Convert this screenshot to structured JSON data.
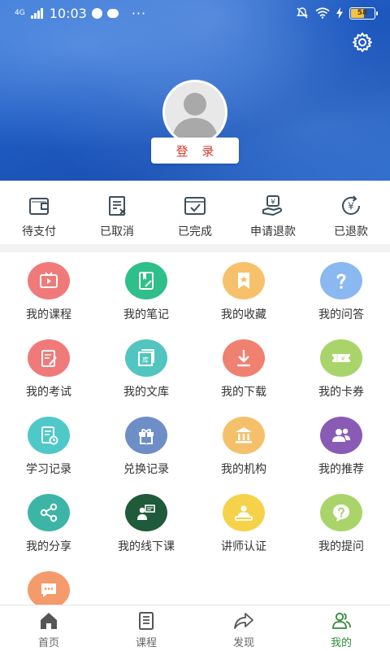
{
  "status_bar": {
    "network": "4G",
    "time": "10:03",
    "more": "···",
    "battery": "58",
    "battery_level_percent": 58
  },
  "header": {
    "login_label": "登 录"
  },
  "orders": [
    {
      "label": "待支付",
      "icon": "wallet-icon"
    },
    {
      "label": "已取消",
      "icon": "cancel-document-icon"
    },
    {
      "label": "已完成",
      "icon": "completed-check-icon"
    },
    {
      "label": "申请退款",
      "icon": "refund-request-icon"
    },
    {
      "label": "已退款",
      "icon": "refunded-yen-icon"
    }
  ],
  "grid": [
    {
      "label": "我的课程",
      "icon": "course-video-icon",
      "color": "#f07a7a"
    },
    {
      "label": "我的笔记",
      "icon": "note-icon",
      "color": "#2fbf8a"
    },
    {
      "label": "我的收藏",
      "icon": "favorite-bookmark-icon",
      "color": "#f7c06a"
    },
    {
      "label": "我的问答",
      "icon": "question-icon",
      "color": "#8ab8f0"
    },
    {
      "label": "我的考试",
      "icon": "exam-icon",
      "color": "#f07a7a"
    },
    {
      "label": "我的文库",
      "icon": "library-icon",
      "color": "#52c5c0"
    },
    {
      "label": "我的下载",
      "icon": "download-icon",
      "color": "#f08070"
    },
    {
      "label": "我的卡券",
      "icon": "coupon-icon",
      "color": "#a9d46a"
    },
    {
      "label": "学习记录",
      "icon": "study-record-icon",
      "color": "#4fc8c8"
    },
    {
      "label": "兑换记录",
      "icon": "gift-icon",
      "color": "#6e8ec7"
    },
    {
      "label": "我的机构",
      "icon": "institution-icon",
      "color": "#f5c06a"
    },
    {
      "label": "我的推荐",
      "icon": "recommend-users-icon",
      "color": "#8a5bb5"
    },
    {
      "label": "我的分享",
      "icon": "share-icon",
      "color": "#3cb5a6"
    },
    {
      "label": "我的线下课",
      "icon": "offline-class-icon",
      "color": "#1f5a3a"
    },
    {
      "label": "讲师认证",
      "icon": "lecturer-icon",
      "color": "#f5d24a"
    },
    {
      "label": "我的提问",
      "icon": "ask-question-icon",
      "color": "#a9d46a"
    },
    {
      "label": "",
      "icon": "message-icon",
      "color": "#f59a6a"
    }
  ],
  "bottom_nav": [
    {
      "label": "首页",
      "icon": "home-icon"
    },
    {
      "label": "课程",
      "icon": "course-list-icon"
    },
    {
      "label": "发现",
      "icon": "discover-icon"
    },
    {
      "label": "我的",
      "icon": "profile-users-icon"
    }
  ],
  "colors": {
    "accent": "#2e8b3a",
    "login_text": "#d33a2c",
    "header_blue": "#1f5bc2"
  }
}
